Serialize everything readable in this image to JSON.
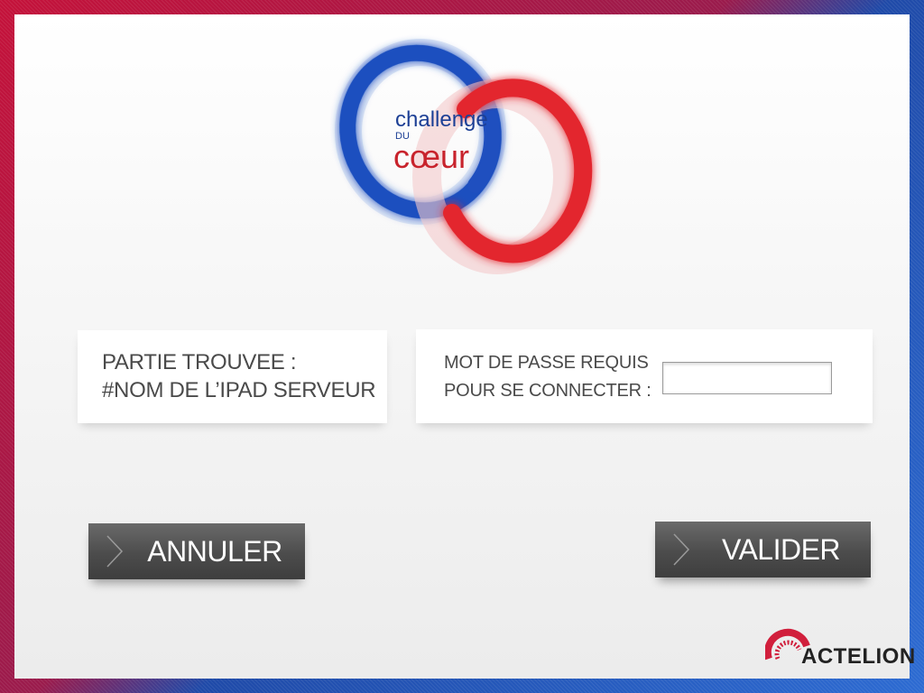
{
  "logo": {
    "line1": "challenge",
    "line2": "DU",
    "line3": "cœur",
    "colors": {
      "blue": "#1f4fbf",
      "red": "#e3262f",
      "text_blue": "#1c3f95",
      "text_red": "#c8232c"
    }
  },
  "found_card": {
    "line1": "PARTIE TROUVEE :",
    "line2": "#NOM DE L’IPAD SERVEUR"
  },
  "password_card": {
    "line1": "MOT DE PASSE REQUIS",
    "line2": "POUR SE CONNECTER :",
    "input_value": ""
  },
  "buttons": {
    "cancel": "ANNULER",
    "validate": "VALIDER"
  },
  "brand": {
    "name": "ACTELION",
    "color": "#d11f3c"
  }
}
